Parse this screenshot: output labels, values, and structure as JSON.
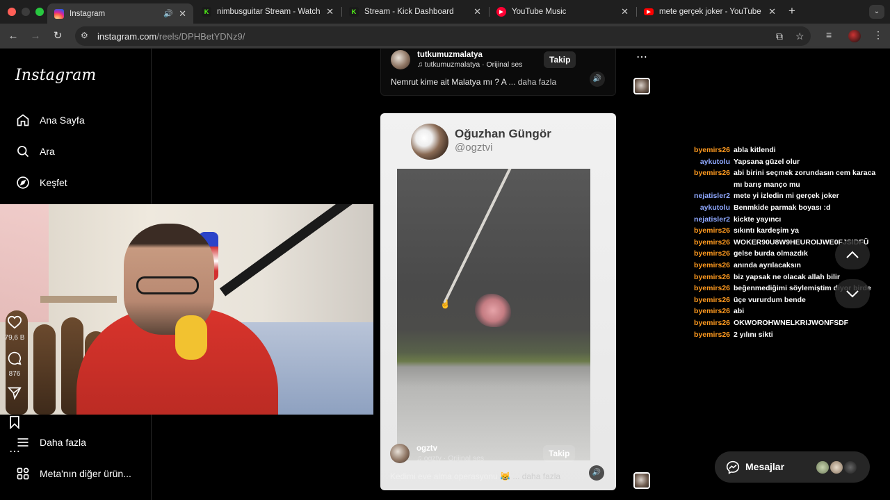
{
  "browser": {
    "tabs": [
      {
        "title": "Instagram",
        "favicon_color": "#d62976",
        "active": true,
        "muted_icon": "speaker-icon"
      },
      {
        "title": "nimbusguitar Stream - Watch",
        "favicon_color": "#53fc18",
        "active": false
      },
      {
        "title": "Stream - Kick Dashboard",
        "favicon_color": "#53fc18",
        "active": false
      },
      {
        "title": "YouTube Music",
        "favicon_color": "#ff0033",
        "active": false
      },
      {
        "title": "mete gerçek joker - YouTube",
        "favicon_color": "#ff0000",
        "active": false
      }
    ],
    "url_host": "instagram.com",
    "url_path": "/reels/DPHBetYDNz9/"
  },
  "sidebar": {
    "logo": "Instagram",
    "items": [
      {
        "label": "Ana Sayfa",
        "icon": "home-icon"
      },
      {
        "label": "Ara",
        "icon": "search-icon"
      },
      {
        "label": "Keşfet",
        "icon": "compass-icon"
      }
    ],
    "bottom_items": [
      {
        "label": "Daha fazla",
        "icon": "menu-icon"
      },
      {
        "label": "Meta'nın diğer ürün...",
        "icon": "apps-icon"
      }
    ]
  },
  "prev_reel": {
    "username": "tutkumuzmalatya",
    "audio": "tutkumuzmalatya · Orijinal ses",
    "follow": "Takip",
    "caption": "Nemrut kime ait Malatya mı ? A",
    "more": "... daha fazla"
  },
  "reel": {
    "tweet_name": "Oğuzhan Güngör",
    "tweet_handle": "@ogztvi",
    "username": "ogztv",
    "audio": "ogztv · Orijinal ses",
    "follow": "Takip",
    "caption": "Kedimi eve alma operasyonu 😹",
    "more": "... daha fazla",
    "likes": "79,6 B",
    "comments": "876"
  },
  "chat": [
    {
      "user": "byemirs26",
      "color": "orange",
      "msg": "abla kitlendi"
    },
    {
      "user": "aykutolu",
      "color": "blue",
      "msg": "Yapsana güzel olur"
    },
    {
      "user": "byemirs26",
      "color": "orange",
      "msg": "abi birini seçmek zorundasın cem karaca mı barış manço mu"
    },
    {
      "user": "nejatisler2",
      "color": "blue",
      "msg": "mete yi izledin mi gerçek joker"
    },
    {
      "user": "aykutolu",
      "color": "blue",
      "msg": "Benmkide parmak boyası :d"
    },
    {
      "user": "nejatisler2",
      "color": "blue",
      "msg": "kickte yayıncı"
    },
    {
      "user": "byemirs26",
      "color": "orange",
      "msg": "sıkıntı kardeşim ya"
    },
    {
      "user": "byemirs26",
      "color": "orange",
      "msg": "WOKER90U8W9HEUROIJWE0FJSIDFÜ"
    },
    {
      "user": "byemirs26",
      "color": "orange",
      "msg": "gelse burda olmazdık"
    },
    {
      "user": "byemirs26",
      "color": "orange",
      "msg": "anında ayrılacaksın"
    },
    {
      "user": "byemirs26",
      "color": "orange",
      "msg": "biz yapsak ne olacak allah bilir"
    },
    {
      "user": "byemirs26",
      "color": "orange",
      "msg": "beğenmediğimi söylemiştim diyor birde"
    },
    {
      "user": "byemirs26",
      "color": "orange",
      "msg": "üçe vururdum bende"
    },
    {
      "user": "byemirs26",
      "color": "orange",
      "msg": "abi"
    },
    {
      "user": "byemirs26",
      "color": "orange",
      "msg": "OKWOROHWNELKRIJWONFSDF"
    },
    {
      "user": "byemirs26",
      "color": "orange",
      "msg": "2 yılını sikti"
    }
  ],
  "messages": {
    "label": "Mesajlar"
  }
}
